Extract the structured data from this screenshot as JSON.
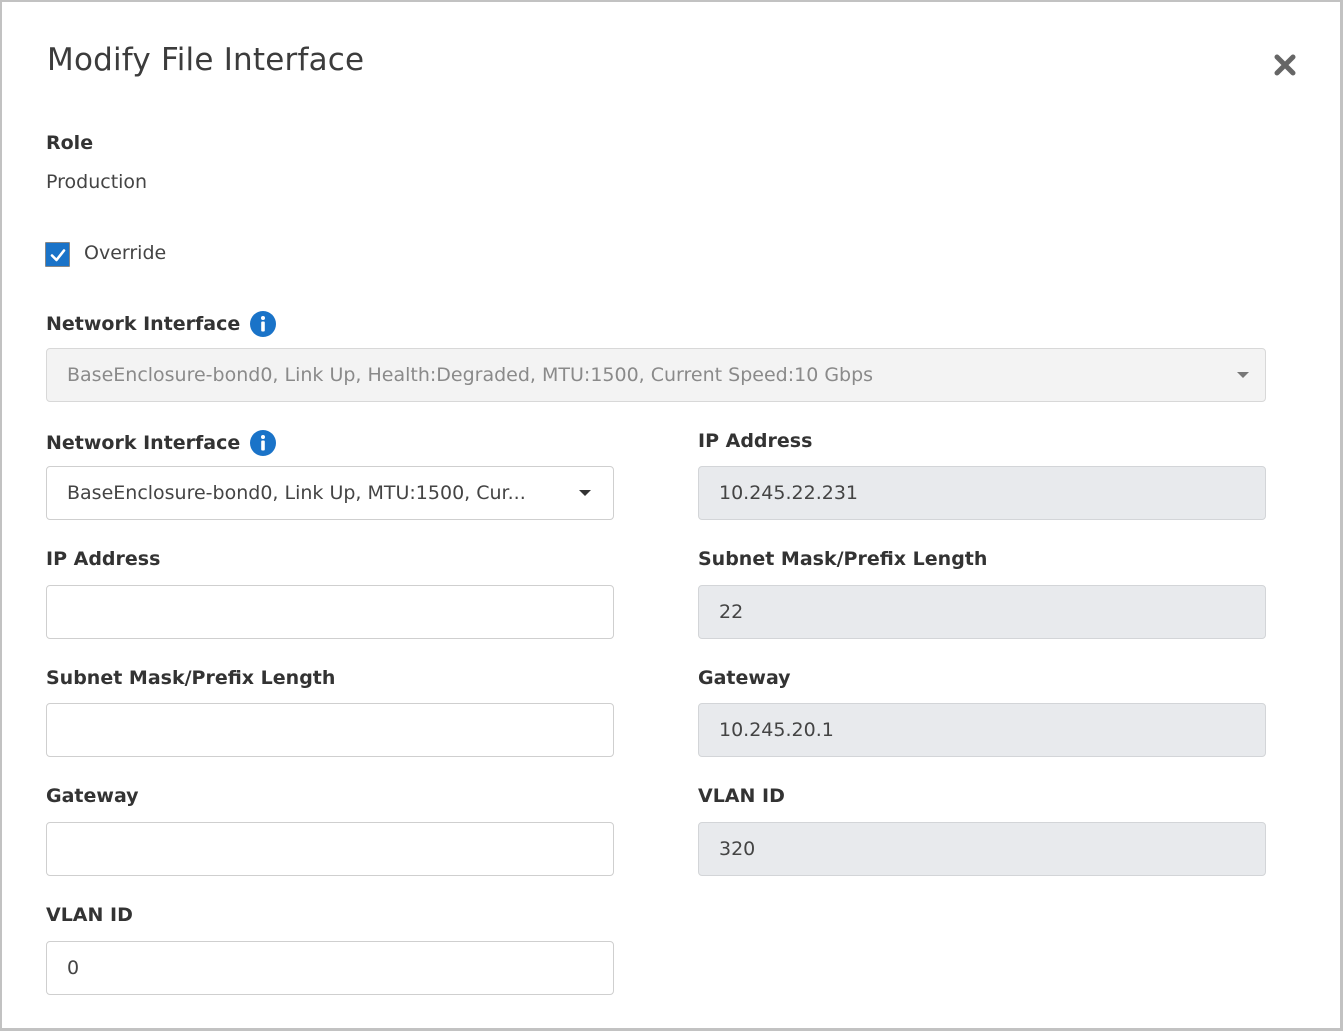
{
  "dialog": {
    "title": "Modify File Interface",
    "close_icon": "close-icon"
  },
  "role": {
    "label": "Role",
    "value": "Production"
  },
  "override": {
    "label": "Override",
    "checked": true
  },
  "primary_interface": {
    "label": "Network Interface",
    "info_icon": "info-icon",
    "value": "BaseEnclosure-bond0, Link Up, Health:Degraded, MTU:1500, Current Speed:10 Gbps",
    "disabled": true
  },
  "left_column": {
    "network_interface": {
      "label": "Network Interface",
      "info_icon": "info-icon",
      "value": "BaseEnclosure-bond0, Link Up, MTU:1500, Cur..."
    },
    "ip_address": {
      "label": "IP Address",
      "value": ""
    },
    "subnet": {
      "label": "Subnet Mask/Prefix Length",
      "value": ""
    },
    "gateway": {
      "label": "Gateway",
      "value": ""
    },
    "vlan_id": {
      "label": "VLAN ID",
      "value": "0"
    }
  },
  "right_column": {
    "ip_address": {
      "label": "IP Address",
      "value": "10.245.22.231"
    },
    "subnet": {
      "label": "Subnet Mask/Prefix Length",
      "value": "22"
    },
    "gateway": {
      "label": "Gateway",
      "value": "10.245.20.1"
    },
    "vlan_id": {
      "label": "VLAN ID",
      "value": "320"
    }
  },
  "colors": {
    "accent": "#1a73c8",
    "readonly_bg": "#e8eaed",
    "disabled_bg": "#f3f3f3"
  }
}
